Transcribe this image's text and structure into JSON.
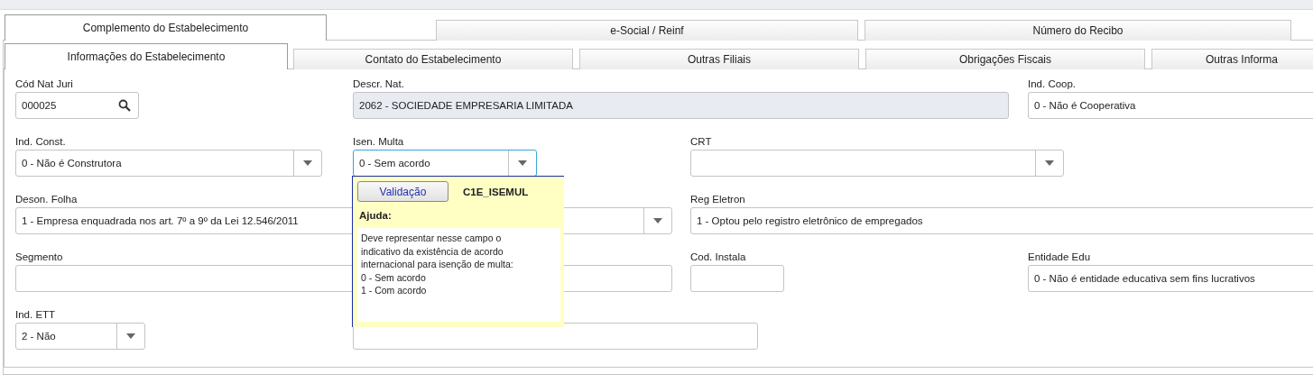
{
  "top_tabs": [
    {
      "label": "Complemento do Estabelecimento",
      "selected": true
    },
    {
      "label": "e-Social / Reinf",
      "selected": false
    },
    {
      "label": "Número do Recibo",
      "selected": false
    }
  ],
  "sub_tabs": [
    {
      "label": "Informações do Estabelecimento",
      "selected": true
    },
    {
      "label": "Contato do Estabelecimento",
      "selected": false
    },
    {
      "label": "Outras Filiais",
      "selected": false
    },
    {
      "label": "Obrigações Fiscais",
      "selected": false
    },
    {
      "label": "Outras Informa",
      "selected": false
    }
  ],
  "fields": [
    {
      "label": "Cód Nat Juri",
      "value": "000025",
      "kind": "lookup",
      "focused": false
    },
    {
      "label": "Descr. Nat.",
      "value": "2062 - SOCIEDADE EMPRESARIA LIMITADA",
      "kind": "readonly",
      "focused": false
    },
    {
      "label": "Ind. Coop.",
      "value": "0 - Não é Cooperativa",
      "kind": "text",
      "focused": false
    },
    {
      "label": "Ind. Const.",
      "value": "0 - Não é Construtora",
      "kind": "combo",
      "focused": false
    },
    {
      "label": "Isen. Multa",
      "value": "0 - Sem acordo",
      "kind": "combo",
      "focused": true
    },
    {
      "label": "CRT",
      "kind": "combo",
      "focused": false
    },
    {
      "label": "Deson. Folha",
      "value": "1 - Empresa enquadrada nos art. 7º a 9º da Lei 12.546/2011",
      "kind": "combo",
      "focused": false
    },
    {
      "label": "Reg Eletron",
      "value": "1 - Optou pelo registro eletrônico de empregados",
      "kind": "text",
      "focused": false
    },
    {
      "label": "Segmento",
      "kind": "text",
      "focused": false
    },
    {
      "label": "Cod. Instala",
      "kind": "text",
      "focused": false
    },
    {
      "label": "Entidade Edu",
      "value": "0 - Não é entidade educativa sem fins lucrativos",
      "kind": "text",
      "focused": false
    },
    {
      "label": "Ind. ETT",
      "value": "2 - Não",
      "kind": "combo",
      "focused": false
    },
    {
      "kind": "text",
      "focused": false
    }
  ],
  "help_popup": {
    "button": "Validação",
    "field_code": "C1E_ISEMUL",
    "heading": "Ajuda:",
    "text": "Deve representar nesse campo o\nindicativo da existência de acordo\ninternacional para isenção de multa:\n0 - Sem acordo\n1 - Com acordo"
  }
}
